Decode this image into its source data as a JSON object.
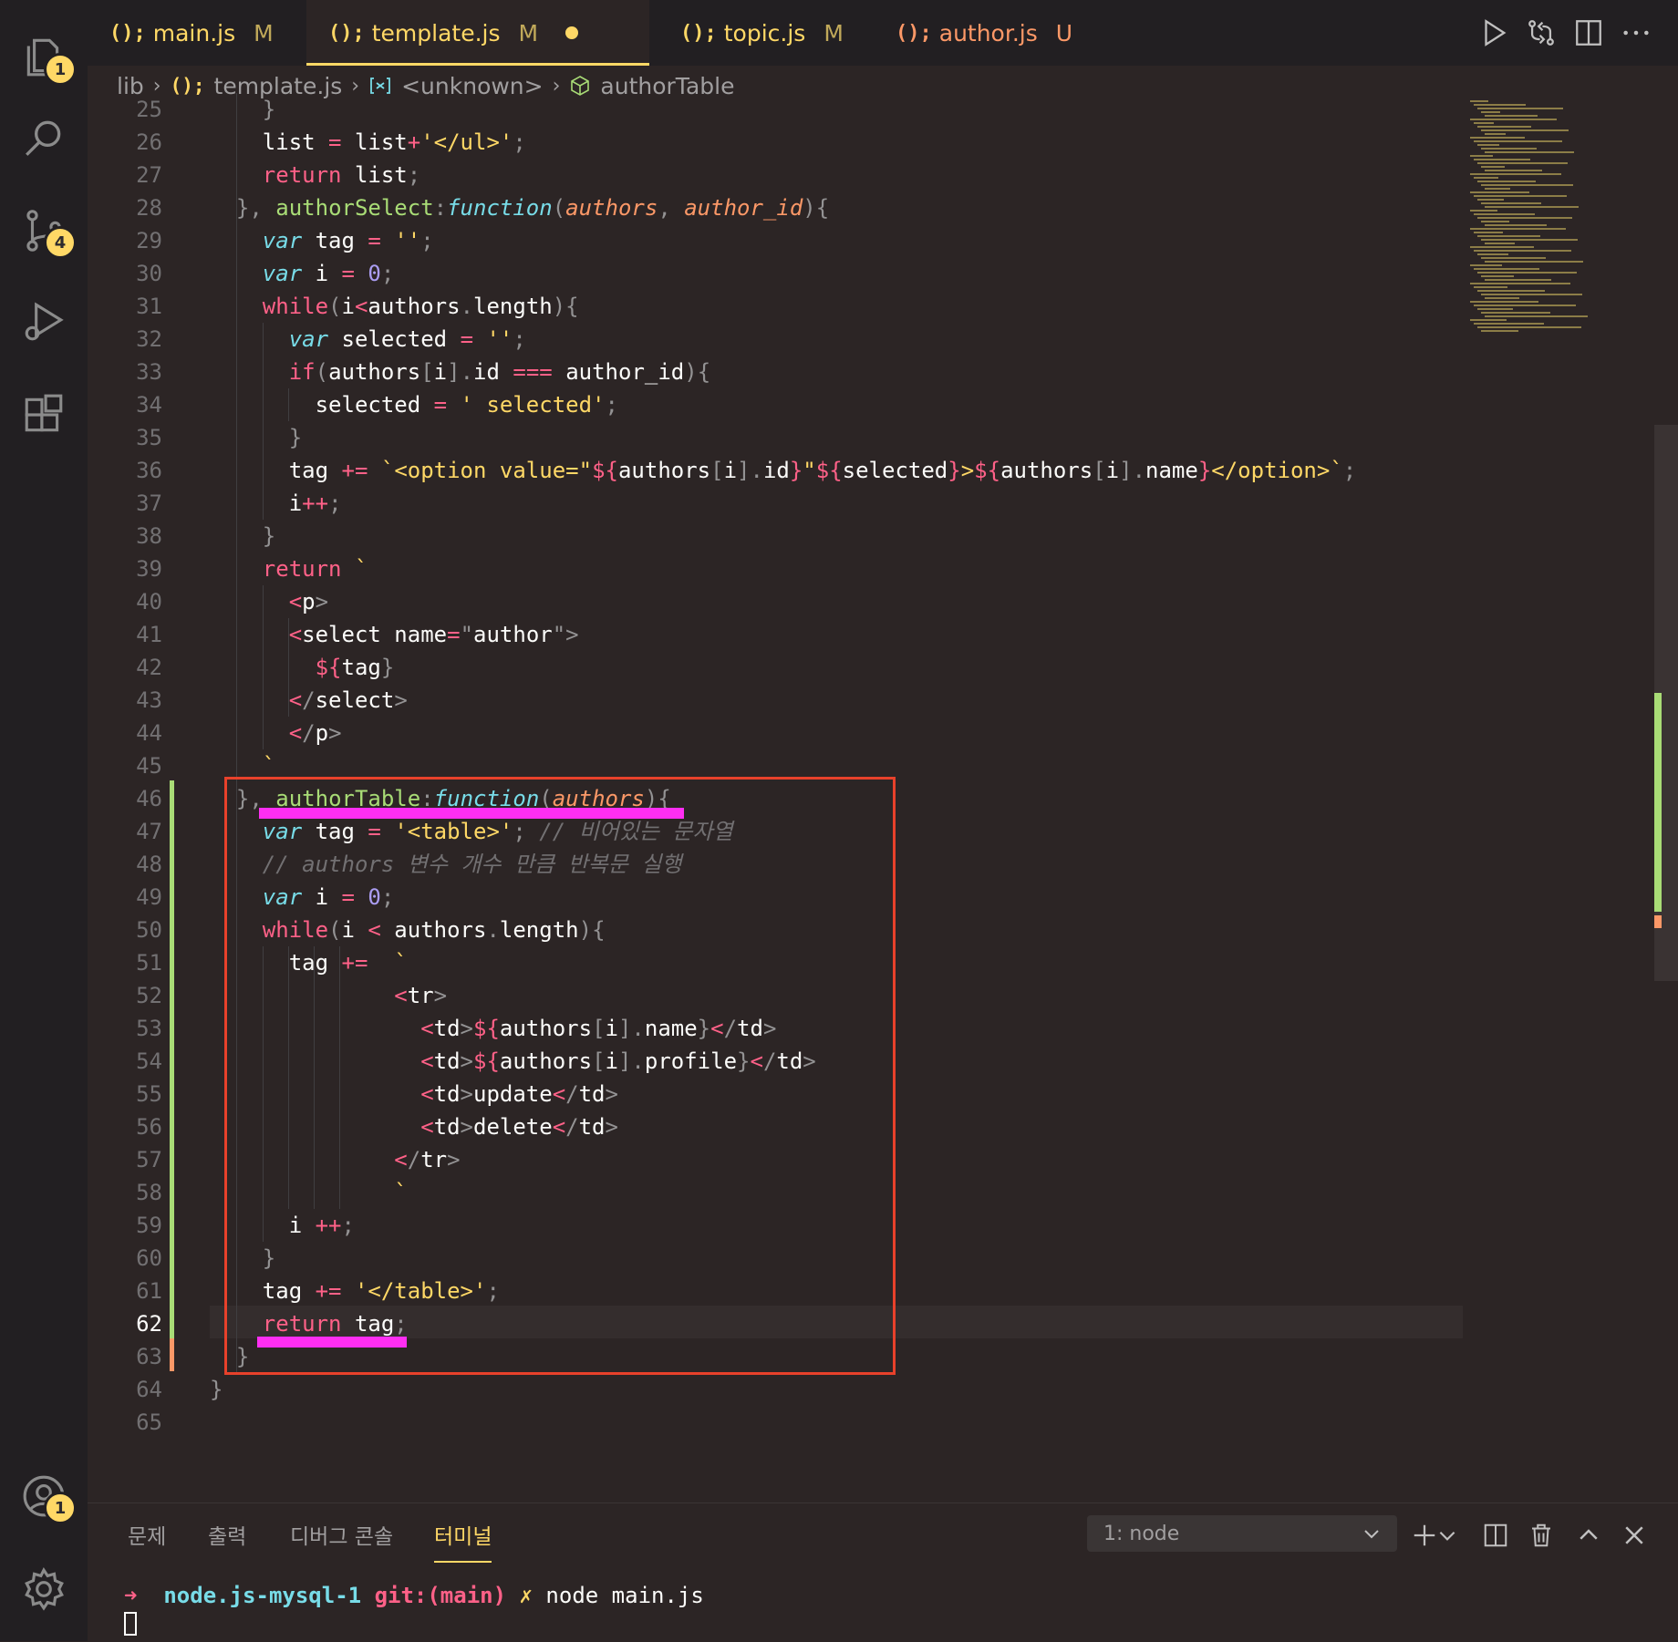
{
  "activity_bar": {
    "explorer_badge": "1",
    "scm_badge": "4",
    "accounts_badge": "1",
    "icons": [
      "files-icon",
      "search-icon",
      "source-control-icon",
      "run-debug-icon",
      "extensions-icon",
      "account-icon",
      "gear-icon"
    ]
  },
  "tabs": [
    {
      "name": "main.js",
      "status": "M"
    },
    {
      "name": "template.js",
      "status": "M"
    },
    {
      "name": "topic.js",
      "status": "M"
    },
    {
      "name": "author.js",
      "status": "U"
    }
  ],
  "file_icon_text": "();",
  "breadcrumb": {
    "folder": "lib",
    "file": "template.js",
    "scope": "<unknown>",
    "symbol": "authorTable"
  },
  "editor": {
    "current_line": 62,
    "lines": [
      {
        "n": "25",
        "text": "    }"
      },
      {
        "n": "26",
        "text": "    list = list+'</ul>';"
      },
      {
        "n": "27",
        "text": "    return list;"
      },
      {
        "n": "28",
        "text": "  }, authorSelect:function(authors, author_id){"
      },
      {
        "n": "29",
        "text": "    var tag = '';"
      },
      {
        "n": "30",
        "text": "    var i = 0;"
      },
      {
        "n": "31",
        "text": "    while(i<authors.length){"
      },
      {
        "n": "32",
        "text": "      var selected = '';"
      },
      {
        "n": "33",
        "text": "      if(authors[i].id === author_id){"
      },
      {
        "n": "34",
        "text": "        selected = ' selected';"
      },
      {
        "n": "35",
        "text": "      }"
      },
      {
        "n": "36",
        "text": "      tag += `<option value=\"${authors[i].id}\"${selected}>${authors[i].name}</option>`;"
      },
      {
        "n": "37",
        "text": "      i++;"
      },
      {
        "n": "38",
        "text": "    }"
      },
      {
        "n": "39",
        "text": "    return `"
      },
      {
        "n": "40",
        "text": "      <p>"
      },
      {
        "n": "41",
        "text": "      <select name=\"author\">"
      },
      {
        "n": "42",
        "text": "        ${tag}"
      },
      {
        "n": "43",
        "text": "      </select>"
      },
      {
        "n": "44",
        "text": "      </p>"
      },
      {
        "n": "45",
        "text": "    `"
      },
      {
        "n": "46",
        "text": "  }, authorTable:function(authors){"
      },
      {
        "n": "47",
        "text": "    var tag = '<table>'; // 비어있는 문자열"
      },
      {
        "n": "48",
        "text": "    // authors 변수 개수 만큼 반복문 실행"
      },
      {
        "n": "49",
        "text": "    var i = 0;"
      },
      {
        "n": "50",
        "text": "    while(i < authors.length){"
      },
      {
        "n": "51",
        "text": "      tag +=  `"
      },
      {
        "n": "52",
        "text": "              <tr>"
      },
      {
        "n": "53",
        "text": "                <td>${authors[i].name}</td>"
      },
      {
        "n": "54",
        "text": "                <td>${authors[i].profile}</td>"
      },
      {
        "n": "55",
        "text": "                <td>update</td>"
      },
      {
        "n": "56",
        "text": "                <td>delete</td>"
      },
      {
        "n": "57",
        "text": "              </tr>"
      },
      {
        "n": "58",
        "text": "              `"
      },
      {
        "n": "59",
        "text": "      i ++;"
      },
      {
        "n": "60",
        "text": "    }"
      },
      {
        "n": "61",
        "text": "    tag += '</table>';"
      },
      {
        "n": "62",
        "text": "    return tag;"
      },
      {
        "n": "63",
        "text": "  }"
      },
      {
        "n": "64",
        "text": "}"
      },
      {
        "n": "65",
        "text": ""
      }
    ]
  },
  "panel": {
    "tabs": [
      "문제",
      "출력",
      "디버그 콘솔",
      "터미널"
    ],
    "active_tab": "터미널",
    "terminal_select": "1: node",
    "terminal": {
      "arrow": "➜",
      "dir": "node.js-mysql-1",
      "git_label": "git:(main)",
      "dirty": "✗",
      "command": "node main.js"
    }
  },
  "colors": {
    "accent": "#ffd866",
    "keyword": "#ff6188",
    "function": "#a9dc76",
    "storage": "#78dce8",
    "param": "#fc9867",
    "number": "#ab9df2",
    "annotation_box": "#e8412b",
    "annotation_underline": "#ff2ef2"
  }
}
